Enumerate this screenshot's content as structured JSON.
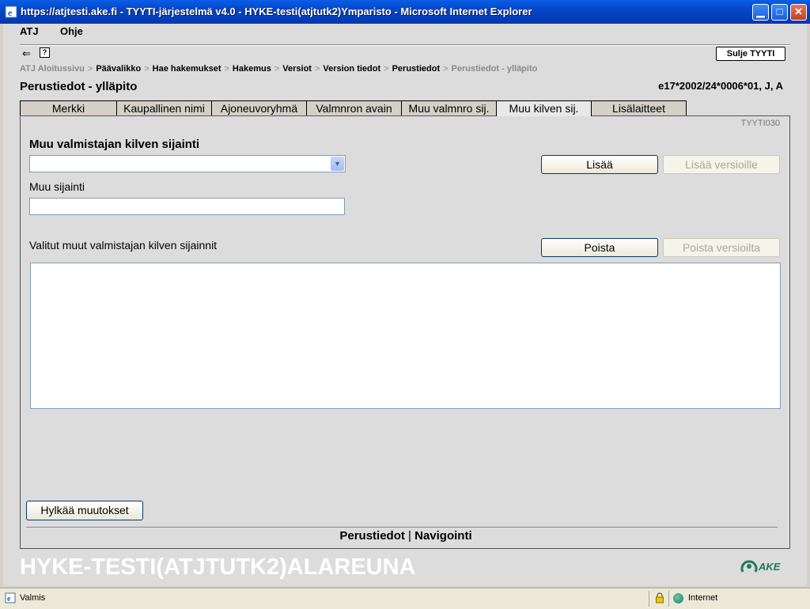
{
  "window": {
    "title": "https://atjtesti.ake.fi - TYYTI-järjestelmä v4.0 - HYKE-testi(atjtutk2)Ymparisto - Microsoft Internet Explorer",
    "min_label": "▁",
    "max_label": "□",
    "close_label": "✕"
  },
  "menu": {
    "atj": "ATJ",
    "help": "Ohje"
  },
  "toolbar": {
    "back_icon": "⇐",
    "help_icon": "?",
    "close_label": "Sulje TYYTI"
  },
  "breadcrumb": {
    "items": [
      "ATJ Aloitussivu",
      "Päävalikko",
      "Hae hakemukset",
      "Hakemus",
      "Versiot",
      "Version tiedot",
      "Perustiedot",
      "Perustiedot - ylläpito"
    ],
    "separator": ">"
  },
  "page": {
    "title": "Perustiedot - ylläpito",
    "id": "e17*2002/24*0006*01, J, A",
    "code": "TYYTI030"
  },
  "tabs": [
    {
      "label": "Merkki"
    },
    {
      "label": "Kaupallinen nimi"
    },
    {
      "label": "Ajoneuvoryhmä"
    },
    {
      "label": "Valmnron avain"
    },
    {
      "label": "Muu valmnro sij."
    },
    {
      "label": "Muu kilven sij."
    },
    {
      "label": "Lisälaitteet"
    }
  ],
  "form": {
    "location_label": "Muu valmistajan kilven sijainti",
    "location_value": "",
    "other_label": "Muu sijainti",
    "other_value": "",
    "selected_label": "Valitut muut valmistajan kilven sijainnit",
    "add": "Lisää",
    "add_versions": "Lisää versioille",
    "remove": "Poista",
    "remove_versions": "Poista versioilta",
    "discard": "Hylkää muutokset"
  },
  "footer": {
    "link1": "Perustiedot",
    "sep": "|",
    "link2": "Navigointi"
  },
  "banner": {
    "text": "HYKE-TESTI(ATJTUTK2)ALAREUNA",
    "logo": "AKE"
  },
  "status": {
    "text": "Valmis",
    "zone": "Internet"
  },
  "colors": {
    "title_bar": "#0546c8",
    "content_bg": "#dcdcdc",
    "link_dim": "#8a8a8a"
  }
}
